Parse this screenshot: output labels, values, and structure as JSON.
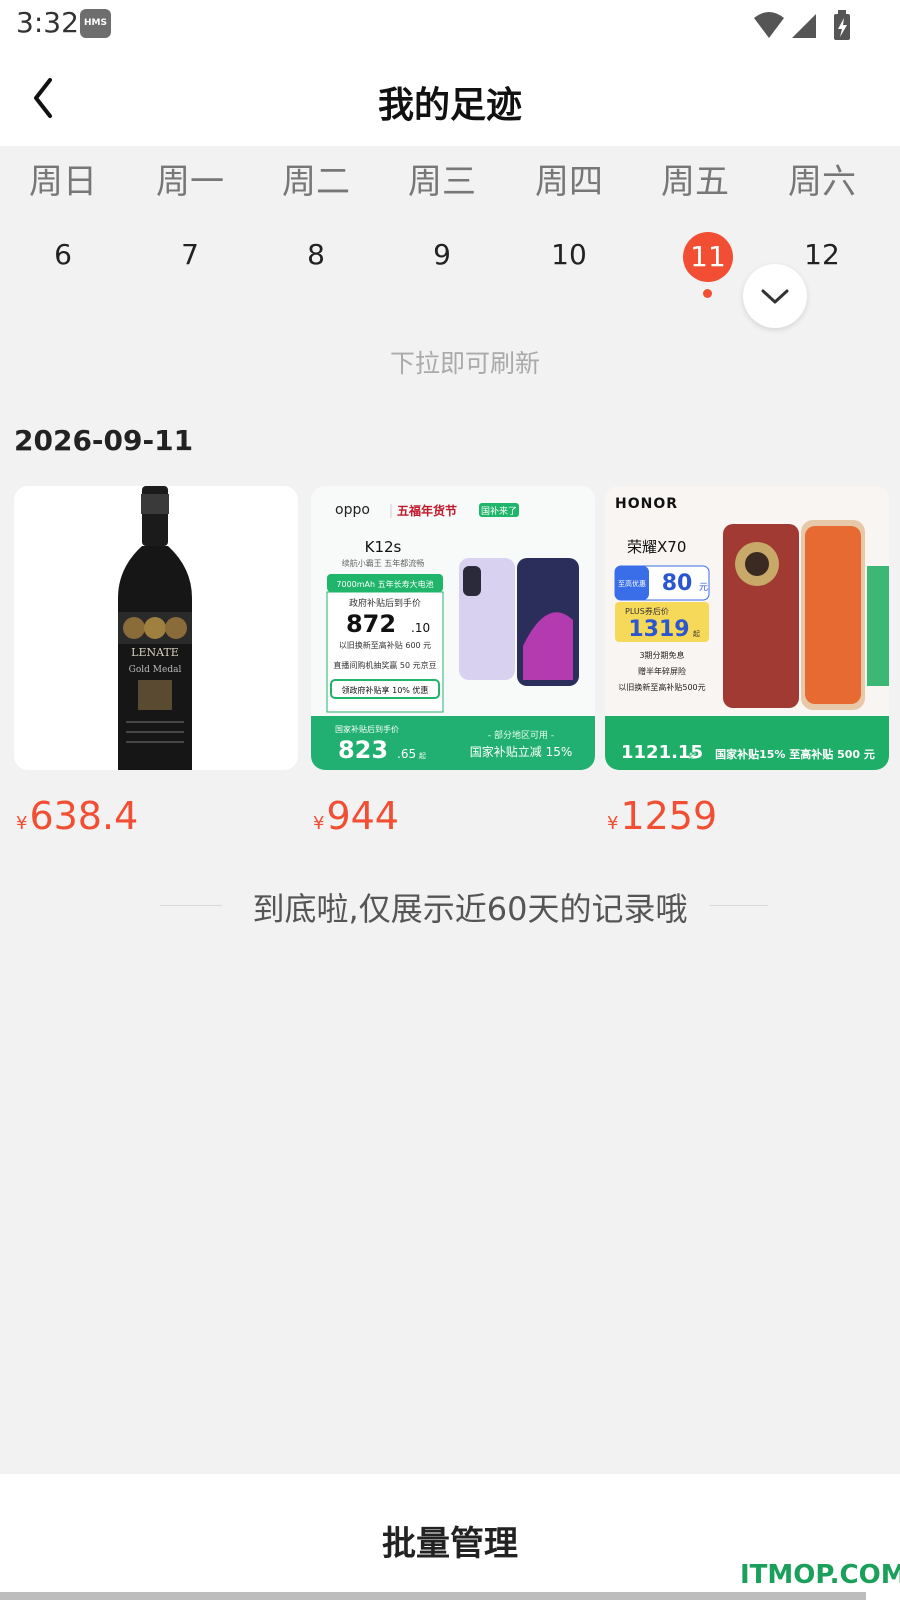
{
  "status_bar": {
    "time": "3:32",
    "badge": "HMS",
    "icons": [
      "wifi-icon",
      "signal-icon",
      "battery-charging-icon"
    ]
  },
  "header": {
    "title": "我的足迹",
    "back_icon": "chevron-left-icon"
  },
  "calendar": {
    "weekdays": [
      "周日",
      "周一",
      "周二",
      "周三",
      "周四",
      "周五",
      "周六"
    ],
    "dates": [
      "6",
      "7",
      "8",
      "9",
      "10",
      "11",
      "12"
    ],
    "selected": "11",
    "accent": "#f24e33",
    "expand_icon": "chevron-down-icon"
  },
  "refresh_hint": "下拉即可刷新",
  "section_date": "2026-09-11",
  "products": [
    {
      "price_symbol": "¥",
      "price": "638.4",
      "image_label": "LENATE",
      "image_sub": "Gold Medal"
    },
    {
      "price_symbol": "¥",
      "price": "944",
      "brand": "oppo",
      "promo": "五福年货节",
      "tag": "国补来了",
      "model": "K12s",
      "slogan": "续航小霸王 五年都流畅",
      "battery": "7000mAh 五年长寿大电池",
      "subsidy_label": "政府补贴后到手价",
      "subsidy_price": "872",
      "subsidy_decimal": ".10",
      "line1": "以旧换新至高补贴 600 元",
      "line2": "直播间购机抽奖赢 50 元京豆",
      "coupon": "领政府补贴享 10% 优惠",
      "bottom_label": "国家补贴后到手价",
      "bottom_price": "823",
      "bottom_decimal": ".65",
      "bottom_unit": "起",
      "region": "- 部分地区可用 -",
      "national": "国家补贴立减 15%"
    },
    {
      "price_symbol": "¥",
      "price": "1259",
      "brand": "HONOR",
      "model": "荣耀X70",
      "discount_label": "至高优惠",
      "discount": "80",
      "discount_unit": "元",
      "plus_label": "PLUS券后价",
      "plus_price": "1319",
      "plus_unit": "起",
      "line1": "3期分期免息",
      "line2": "赠半年碎屏险",
      "line3": "以旧换新至高补贴500元",
      "bottom_price": "1121.15",
      "bottom_unit": "起",
      "national": "国家补贴15% 至高补贴 500 元"
    }
  ],
  "end_message": "到底啦,仅展示近60天的记录哦",
  "bottom": {
    "batch_label": "批量管理"
  },
  "watermark": "ITMOP.COM"
}
